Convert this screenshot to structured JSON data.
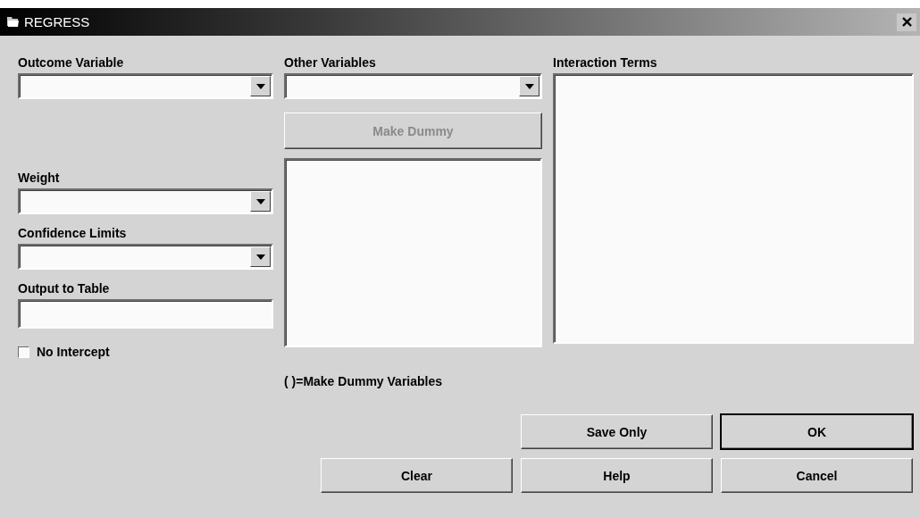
{
  "window": {
    "title": "REGRESS"
  },
  "outcome_variable": {
    "label": "Outcome Variable"
  },
  "weight": {
    "label": "Weight"
  },
  "confidence_limits": {
    "label": "Confidence Limits"
  },
  "output_to_table": {
    "label": "Output to Table"
  },
  "no_intercept": {
    "label": "No Intercept",
    "checked": false
  },
  "other_variables": {
    "label": "Other Variables"
  },
  "make_dummy_button": {
    "label": "Make Dummy",
    "disabled": true
  },
  "dummy_note": "( )=Make Dummy Variables",
  "interaction_terms": {
    "label": "Interaction Terms"
  },
  "buttons": [
    {
      "label": "Save Only",
      "default": false
    },
    {
      "label": "OK",
      "default": true
    },
    {
      "label": "Clear",
      "default": false
    },
    {
      "label": "Help",
      "default": false
    },
    {
      "label": "Cancel",
      "default": false
    }
  ]
}
